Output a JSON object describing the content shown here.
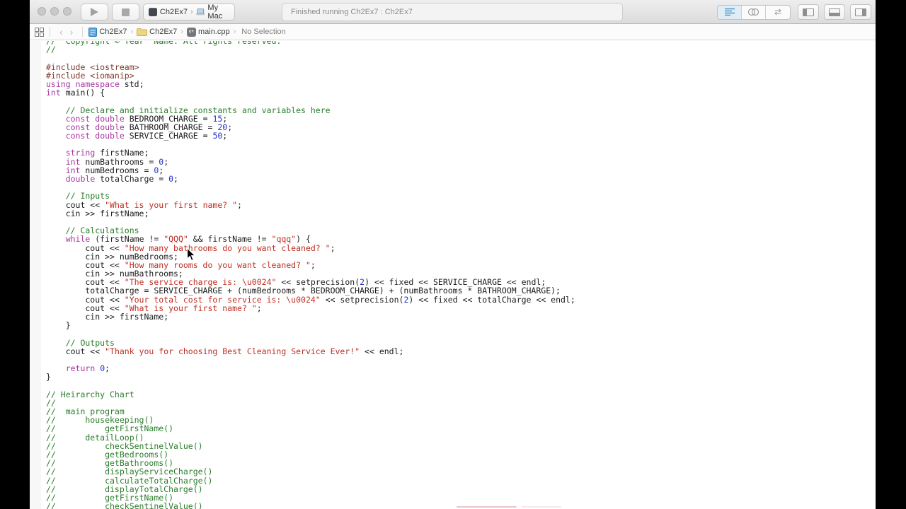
{
  "window": {
    "traffic_lights": [
      "close",
      "minimize",
      "zoom"
    ],
    "toolbar": {
      "status_text": "Finished running Ch2Ex7 : Ch2Ex7",
      "scheme_target": "Ch2Ex7",
      "scheme_destination": "My Mac",
      "editor_modes": [
        "standard-editor",
        "assistant-editor",
        "version-editor"
      ],
      "view_toggles": [
        "navigator-panel",
        "debug-area-panel",
        "utilities-panel"
      ]
    },
    "jump_bar": {
      "project": "Ch2Ex7",
      "group": "Ch2Ex7",
      "file": "main.cpp",
      "selection": "No Selection"
    }
  },
  "colors": {
    "comment": "#2b7d2b",
    "keyword": "#a937a0",
    "number": "#2431cb",
    "string": "#c02e23",
    "preprocessor": "#7a3a2d",
    "plain": "#1b1b1b",
    "active-editor-icon": "#4d9bcb"
  },
  "editor": {
    "lines": [
      [
        [
          "cm",
          "//  Copyright © Year  Name. All rights reserved."
        ]
      ],
      [
        [
          "cm",
          "//"
        ]
      ],
      [],
      [
        [
          "pre",
          "#include <iostream>"
        ]
      ],
      [
        [
          "pre",
          "#include <iomanip>"
        ]
      ],
      [
        [
          "kw",
          "using"
        ],
        [
          "pl",
          " "
        ],
        [
          "kw",
          "namespace"
        ],
        [
          "pl",
          " std;"
        ]
      ],
      [
        [
          "kw",
          "int"
        ],
        [
          "pl",
          " main() {"
        ]
      ],
      [],
      [
        [
          "pl",
          "    "
        ],
        [
          "cm",
          "// Declare and initialize constants and variables here"
        ]
      ],
      [
        [
          "pl",
          "    "
        ],
        [
          "kw",
          "const"
        ],
        [
          "pl",
          " "
        ],
        [
          "kw",
          "double"
        ],
        [
          "pl",
          " BEDROOM_CHARGE = "
        ],
        [
          "num",
          "15"
        ],
        [
          "pl",
          ";"
        ]
      ],
      [
        [
          "pl",
          "    "
        ],
        [
          "kw",
          "const"
        ],
        [
          "pl",
          " "
        ],
        [
          "kw",
          "double"
        ],
        [
          "pl",
          " BATHROOM_CHARGE = "
        ],
        [
          "num",
          "20"
        ],
        [
          "pl",
          ";"
        ]
      ],
      [
        [
          "pl",
          "    "
        ],
        [
          "kw",
          "const"
        ],
        [
          "pl",
          " "
        ],
        [
          "kw",
          "double"
        ],
        [
          "pl",
          " SERVICE_CHARGE = "
        ],
        [
          "num",
          "50"
        ],
        [
          "pl",
          ";"
        ]
      ],
      [],
      [
        [
          "pl",
          "    "
        ],
        [
          "kw",
          "string"
        ],
        [
          "pl",
          " firstName;"
        ]
      ],
      [
        [
          "pl",
          "    "
        ],
        [
          "kw",
          "int"
        ],
        [
          "pl",
          " numBathrooms = "
        ],
        [
          "num",
          "0"
        ],
        [
          "pl",
          ";"
        ]
      ],
      [
        [
          "pl",
          "    "
        ],
        [
          "kw",
          "int"
        ],
        [
          "pl",
          " numBedrooms = "
        ],
        [
          "num",
          "0"
        ],
        [
          "pl",
          ";"
        ]
      ],
      [
        [
          "pl",
          "    "
        ],
        [
          "kw",
          "double"
        ],
        [
          "pl",
          " totalCharge = "
        ],
        [
          "num",
          "0"
        ],
        [
          "pl",
          ";"
        ]
      ],
      [],
      [
        [
          "pl",
          "    "
        ],
        [
          "cm",
          "// Inputs"
        ]
      ],
      [
        [
          "pl",
          "    cout << "
        ],
        [
          "str",
          "\"What is your first name? \""
        ],
        [
          "pl",
          ";"
        ]
      ],
      [
        [
          "pl",
          "    cin >> firstName;"
        ]
      ],
      [],
      [
        [
          "pl",
          "    "
        ],
        [
          "cm",
          "// Calculations"
        ]
      ],
      [
        [
          "pl",
          "    "
        ],
        [
          "kw",
          "while"
        ],
        [
          "pl",
          " (firstName != "
        ],
        [
          "str",
          "\"QQQ\""
        ],
        [
          "pl",
          " && firstName != "
        ],
        [
          "str",
          "\"qqq\""
        ],
        [
          "pl",
          ") {"
        ]
      ],
      [
        [
          "pl",
          "        cout << "
        ],
        [
          "str",
          "\"How many bathrooms do you want cleaned? \""
        ],
        [
          "pl",
          ";"
        ]
      ],
      [
        [
          "pl",
          "        cin >> numBedrooms;"
        ]
      ],
      [
        [
          "pl",
          "        cout << "
        ],
        [
          "str",
          "\"How many rooms do you want cleaned? \""
        ],
        [
          "pl",
          ";"
        ]
      ],
      [
        [
          "pl",
          "        cin >> numBathrooms;"
        ]
      ],
      [
        [
          "pl",
          "        cout << "
        ],
        [
          "str",
          "\"The service charge is: \\u0024\""
        ],
        [
          "pl",
          " << setprecision("
        ],
        [
          "num",
          "2"
        ],
        [
          "pl",
          ") << fixed << SERVICE_CHARGE << endl;"
        ]
      ],
      [
        [
          "pl",
          "        totalCharge = SERVICE_CHARGE + (numBedrooms * BEDROOM_CHARGE) + (numBathrooms * BATHROOM_CHARGE);"
        ]
      ],
      [
        [
          "pl",
          "        cout << "
        ],
        [
          "str",
          "\"Your total cost for service is: \\u0024\""
        ],
        [
          "pl",
          " << setprecision("
        ],
        [
          "num",
          "2"
        ],
        [
          "pl",
          ") << fixed << totalCharge << endl;"
        ]
      ],
      [
        [
          "pl",
          "        cout << "
        ],
        [
          "str",
          "\"What is your first name? \""
        ],
        [
          "pl",
          ";"
        ]
      ],
      [
        [
          "pl",
          "        cin >> firstName;"
        ]
      ],
      [
        [
          "pl",
          "    }"
        ]
      ],
      [],
      [
        [
          "pl",
          "    "
        ],
        [
          "cm",
          "// Outputs"
        ]
      ],
      [
        [
          "pl",
          "    cout << "
        ],
        [
          "str",
          "\"Thank you for choosing Best Cleaning Service Ever!\""
        ],
        [
          "pl",
          " << endl;"
        ]
      ],
      [],
      [
        [
          "pl",
          "    "
        ],
        [
          "kw",
          "return"
        ],
        [
          "pl",
          " "
        ],
        [
          "num",
          "0"
        ],
        [
          "pl",
          ";"
        ]
      ],
      [
        [
          "pl",
          "}"
        ]
      ],
      [],
      [
        [
          "cm",
          "// Heirarchy Chart"
        ]
      ],
      [
        [
          "cm",
          "//"
        ]
      ],
      [
        [
          "cm",
          "//  main program"
        ]
      ],
      [
        [
          "cm",
          "//      housekeeping()"
        ]
      ],
      [
        [
          "cm",
          "//          getFirstName()"
        ]
      ],
      [
        [
          "cm",
          "//      detailLoop()"
        ]
      ],
      [
        [
          "cm",
          "//          checkSentinelValue()"
        ]
      ],
      [
        [
          "cm",
          "//          getBedrooms()"
        ]
      ],
      [
        [
          "cm",
          "//          getBathrooms()"
        ]
      ],
      [
        [
          "cm",
          "//          displayServiceCharge()"
        ]
      ],
      [
        [
          "cm",
          "//          calculateTotalCharge()"
        ]
      ],
      [
        [
          "cm",
          "//          displayTotalCharge()"
        ]
      ],
      [
        [
          "cm",
          "//          getFirstName()"
        ]
      ],
      [
        [
          "cm",
          "//          checkSentinelValue()"
        ]
      ]
    ]
  }
}
